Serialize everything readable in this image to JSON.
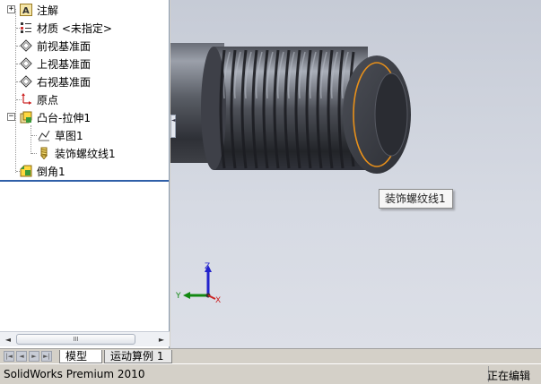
{
  "feature_tree": {
    "items": [
      {
        "label": "注解",
        "icon": "annotation-icon"
      },
      {
        "label": "材质 <未指定>",
        "icon": "material-icon"
      },
      {
        "label": "前视基准面",
        "icon": "plane-icon"
      },
      {
        "label": "上视基准面",
        "icon": "plane-icon"
      },
      {
        "label": "右视基准面",
        "icon": "plane-icon"
      },
      {
        "label": "原点",
        "icon": "origin-icon"
      },
      {
        "label": "凸台-拉伸1",
        "icon": "extrude-icon"
      },
      {
        "label": "草图1",
        "icon": "sketch-icon"
      },
      {
        "label": "装饰螺纹线1",
        "icon": "cosmetic-thread-icon"
      },
      {
        "label": "倒角1",
        "icon": "chamfer-icon"
      }
    ],
    "scrollbar_thumb": "III"
  },
  "viewport": {
    "tooltip": "装饰螺纹线1",
    "triad": {
      "x": "X",
      "y": "Y",
      "z": "Z"
    }
  },
  "tabs": [
    {
      "label": "模型"
    },
    {
      "label": "运动算例 1"
    }
  ],
  "status": {
    "product": "SolidWorks Premium 2010",
    "state": "正在编辑"
  },
  "colors": {
    "selection_edge": "#e8901a",
    "rollback_bar": "#2f5fa8"
  }
}
